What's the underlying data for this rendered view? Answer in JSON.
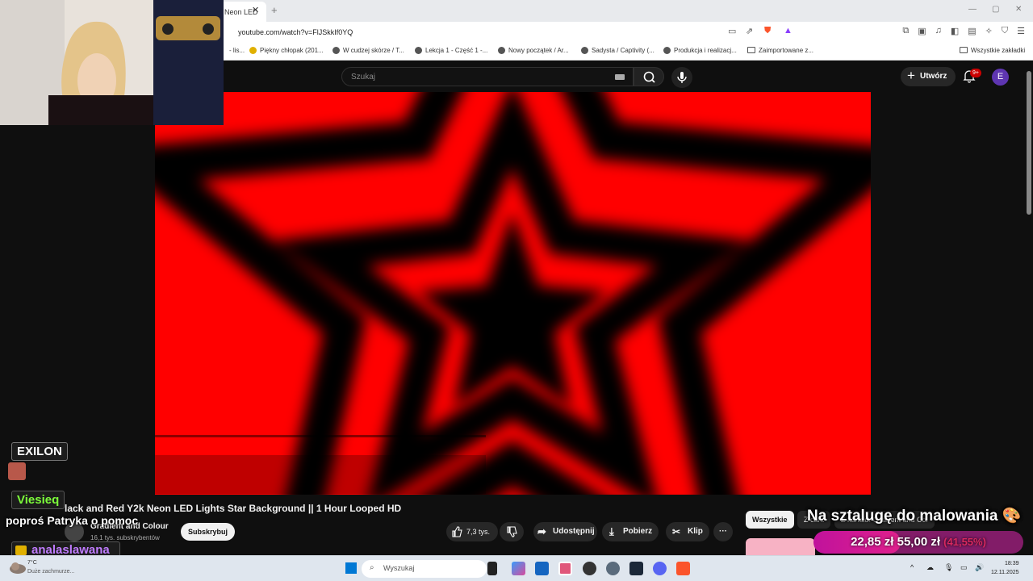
{
  "browser": {
    "tab_title": "Neon LED",
    "tab_close": "✕",
    "new_tab": "+",
    "url": "youtube.com/watch?v=FlJSkkIf0YQ",
    "bookmarks": [
      "- lis...",
      "Piękny chłopak (201...",
      "W cudzej skórze / T...",
      "Lekcja 1 - Część 1 -...",
      "Nowy początek / Ar...",
      "Sadysta / Captivity (...",
      "Produkcja i realizacj...",
      "Zaimportowane z...",
      "Wszystkie zakładki"
    ]
  },
  "youtube": {
    "search_placeholder": "Szukaj",
    "create_label": "Utwórz",
    "notifications_badge": "9+",
    "avatar_letter": "E",
    "video_title": "lack and Red Y2k Neon LED Lights Star Background || 1 Hour Looped HD",
    "channel_name": "Gradient and Colour",
    "channel_subs": "16,1 tys. subskrybentów",
    "subscribe_label": "Subskrybuj",
    "likes": "7,3 tys.",
    "share_label": "Udostępnij",
    "download_label": "Pobierz",
    "clip_label": "Klip",
    "more_label": "···",
    "chips": [
      "Wszystkie",
      "Z cant",
      "Z kanału: Gradient and Col"
    ],
    "accent_color": "#ff0000"
  },
  "stream_overlay": {
    "users": [
      {
        "name": "EXILON",
        "color": "#ffffff"
      },
      {
        "name": "Viesieq",
        "color": "#7cfc3a"
      },
      {
        "name": "analaslawana",
        "color": "#c07cff"
      }
    ],
    "chat_message": "poproś Patryka o pomoc",
    "goal_title": "Na sztalugę do malowania 🎨",
    "goal_current": "22,85 zł",
    "goal_target": "55,00 zł",
    "goal_percent": "(41,55%)",
    "goal_progress": 0.4155
  },
  "taskbar": {
    "weather_temp": "7°C",
    "weather_desc": "Duże zachmurze...",
    "search_label": "Wyszukaj",
    "time": "18:39",
    "date": "12.11.2025",
    "tray_arrow": "^"
  }
}
